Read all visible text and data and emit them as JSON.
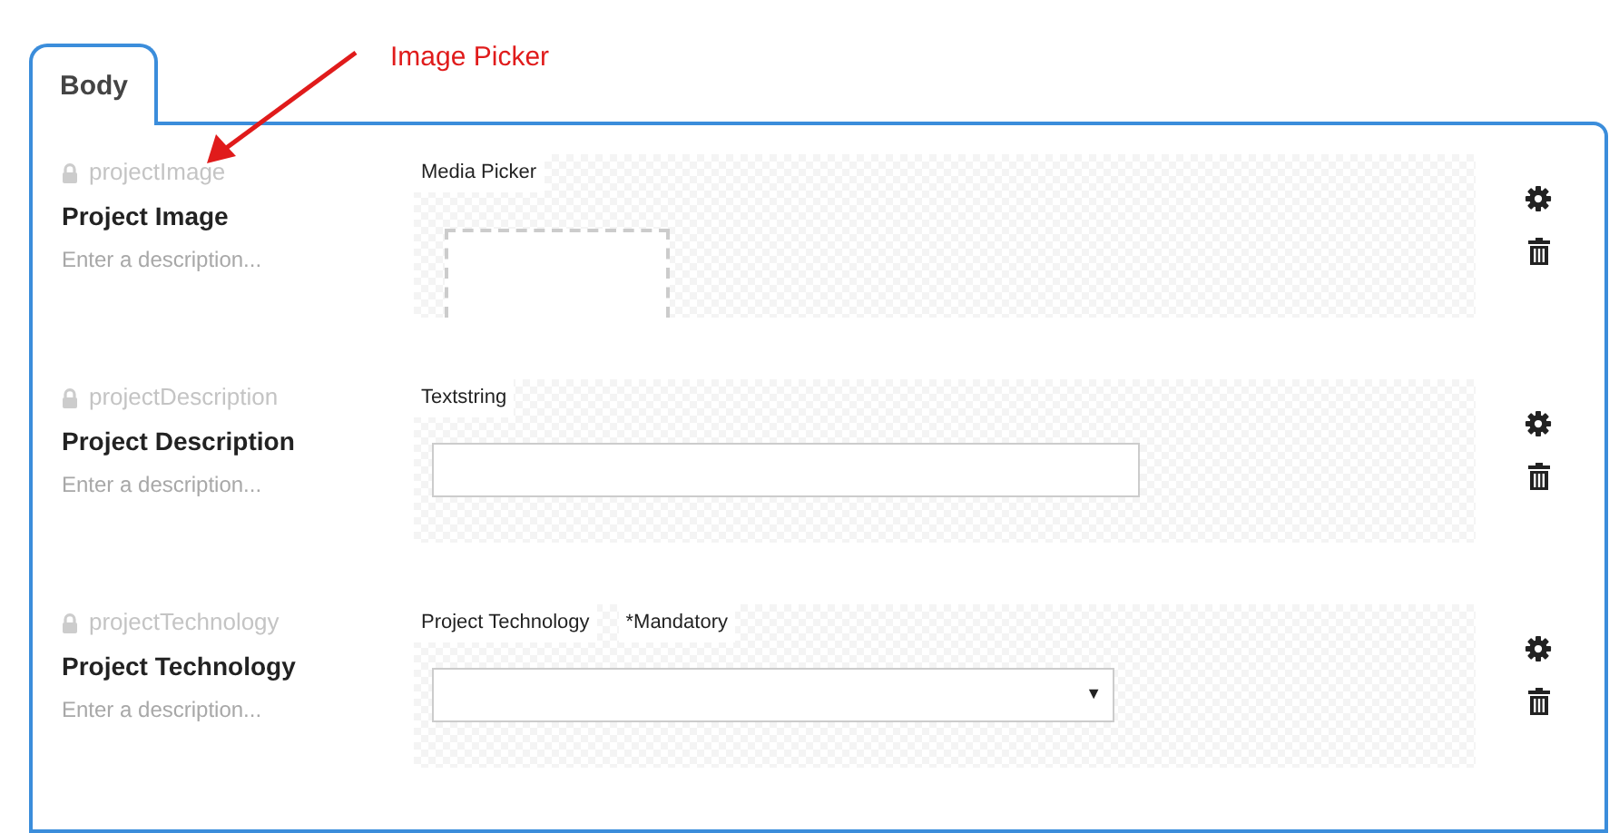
{
  "tabs": [
    {
      "label": "Body",
      "selected": true
    }
  ],
  "annotation": {
    "text": "Image Picker"
  },
  "properties": [
    {
      "alias": "projectImage",
      "locked": true,
      "name": "Project Image",
      "description": {
        "placeholder": "Enter a description..."
      },
      "editor": {
        "label": "Media Picker",
        "kind": "media"
      }
    },
    {
      "alias": "projectDescription",
      "locked": true,
      "name": "Project Description",
      "description": {
        "placeholder": "Enter a description..."
      },
      "editor": {
        "label": "Textstring",
        "kind": "textstring"
      }
    },
    {
      "alias": "projectTechnology",
      "locked": true,
      "name": "Project Technology",
      "description": {
        "placeholder": "Enter a description..."
      },
      "editor": {
        "label": "Project Technology",
        "mandatory": "*Mandatory",
        "kind": "dropdown",
        "caret": "▼"
      }
    }
  ]
}
